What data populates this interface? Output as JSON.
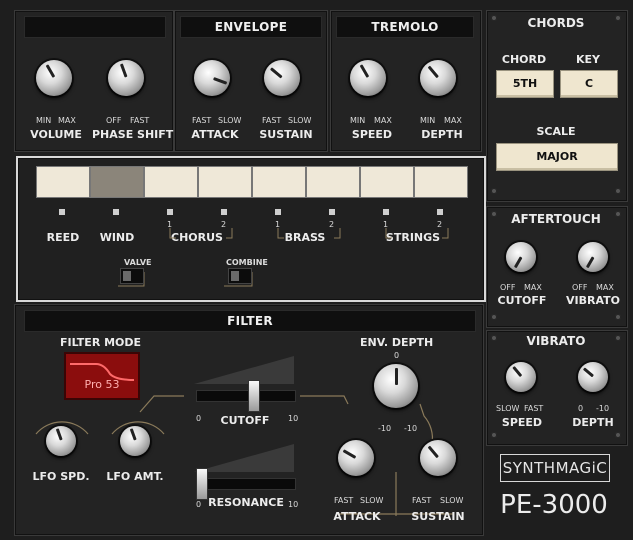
{
  "top": {
    "volume": {
      "label": "VOLUME",
      "min": "MIN",
      "max": "MAX"
    },
    "phase_shift": {
      "label": "PHASE SHIFT",
      "min": "OFF",
      "max": "FAST"
    },
    "envelope": {
      "title": "ENVELOPE",
      "attack": {
        "label": "ATTACK",
        "min": "FAST",
        "max": "SLOW"
      },
      "sustain": {
        "label": "SUSTAIN",
        "min": "FAST",
        "max": "SLOW"
      }
    },
    "tremolo": {
      "title": "TREMOLO",
      "speed": {
        "label": "SPEED",
        "min": "MIN",
        "max": "MAX"
      },
      "depth": {
        "label": "DEPTH",
        "min": "MIN",
        "max": "MAX"
      }
    }
  },
  "chords": {
    "title": "CHORDS",
    "chord_label": "CHORD",
    "chord_value": "5TH",
    "key_label": "KEY",
    "key_value": "C",
    "scale_label": "SCALE",
    "scale_value": "MAJOR"
  },
  "voices": {
    "reed": "REED",
    "wind": "WIND",
    "chorus": "CHORUS",
    "brass": "BRASS",
    "strings": "STRINGS",
    "n1": "1",
    "n2": "2",
    "valve": "VALVE",
    "combine": "COMBINE"
  },
  "aftertouch": {
    "title": "AFTERTOUCH",
    "cutoff": {
      "label": "CUTOFF",
      "min": "OFF",
      "max": "MAX"
    },
    "vibrato": {
      "label": "VIBRATO",
      "min": "OFF",
      "max": "MAX"
    }
  },
  "vibrato": {
    "title": "VIBRATO",
    "speed": {
      "label": "SPEED",
      "min": "SLOW",
      "max": "FAST"
    },
    "depth": {
      "label": "DEPTH",
      "min": "0",
      "max": "-10"
    }
  },
  "filter": {
    "title": "FILTER",
    "mode_label": "FILTER MODE",
    "mode_value": "Pro 53",
    "lfo_spd": "LFO SPD.",
    "lfo_amt": "LFO AMT.",
    "cutoff": "CUTOFF",
    "resonance": "RESONANCE",
    "slider_min": "0",
    "slider_max": "10",
    "env_depth": "ENV. DEPTH",
    "env_zero": "0",
    "env_min": "-10",
    "env_max": "-10",
    "attack": {
      "label": "ATTACK",
      "min": "FAST",
      "max": "SLOW"
    },
    "sustain": {
      "label": "SUSTAIN",
      "min": "FAST",
      "max": "SLOW"
    }
  },
  "brand": {
    "logo": "SYNTHMAGiC",
    "model": "PE-3000"
  }
}
